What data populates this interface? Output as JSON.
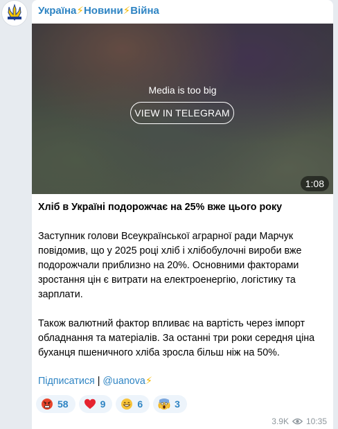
{
  "channel": {
    "name_parts": [
      "Україна",
      "⚡",
      "Новини",
      "⚡",
      "Війна"
    ]
  },
  "media": {
    "note": "Media is too big",
    "button_label": "VIEW IN TELEGRAM",
    "duration": "1:08"
  },
  "post": {
    "headline": "Хліб в Україні подорожчає на 25% вже цього року",
    "paragraphs": [
      "Заступник голови Всеукраїнської аграрної ради Марчук повідомив, що у 2025 році хліб і хлібобулочні вироби вже подорожчали приблизно на 20%. Основними факторами зростання цін є витрати на електроенергію, логістику та зарплати.",
      "Також валютний фактор впливає на вартість через імпорт обладнання та матеріалів. За останні три роки середня ціна буханця пшеничного хліба зросла більш ніж на 50%."
    ],
    "subscribe_link": "Підписатися",
    "separator": "|",
    "handle_link": "@uanova",
    "bolt": "⚡"
  },
  "reactions": [
    {
      "icon": "angry-face-icon",
      "count": "58"
    },
    {
      "icon": "red-heart-icon",
      "count": "9"
    },
    {
      "icon": "grinning-face-icon",
      "count": "6"
    },
    {
      "icon": "screaming-face-icon",
      "count": "3"
    }
  ],
  "meta": {
    "views": "3.9K",
    "time": "10:35"
  },
  "colors": {
    "accent": "#2e84c3",
    "bolt": "#f5b800",
    "background": "#e7ebf0",
    "reaction_bg": "#edf4fb"
  }
}
